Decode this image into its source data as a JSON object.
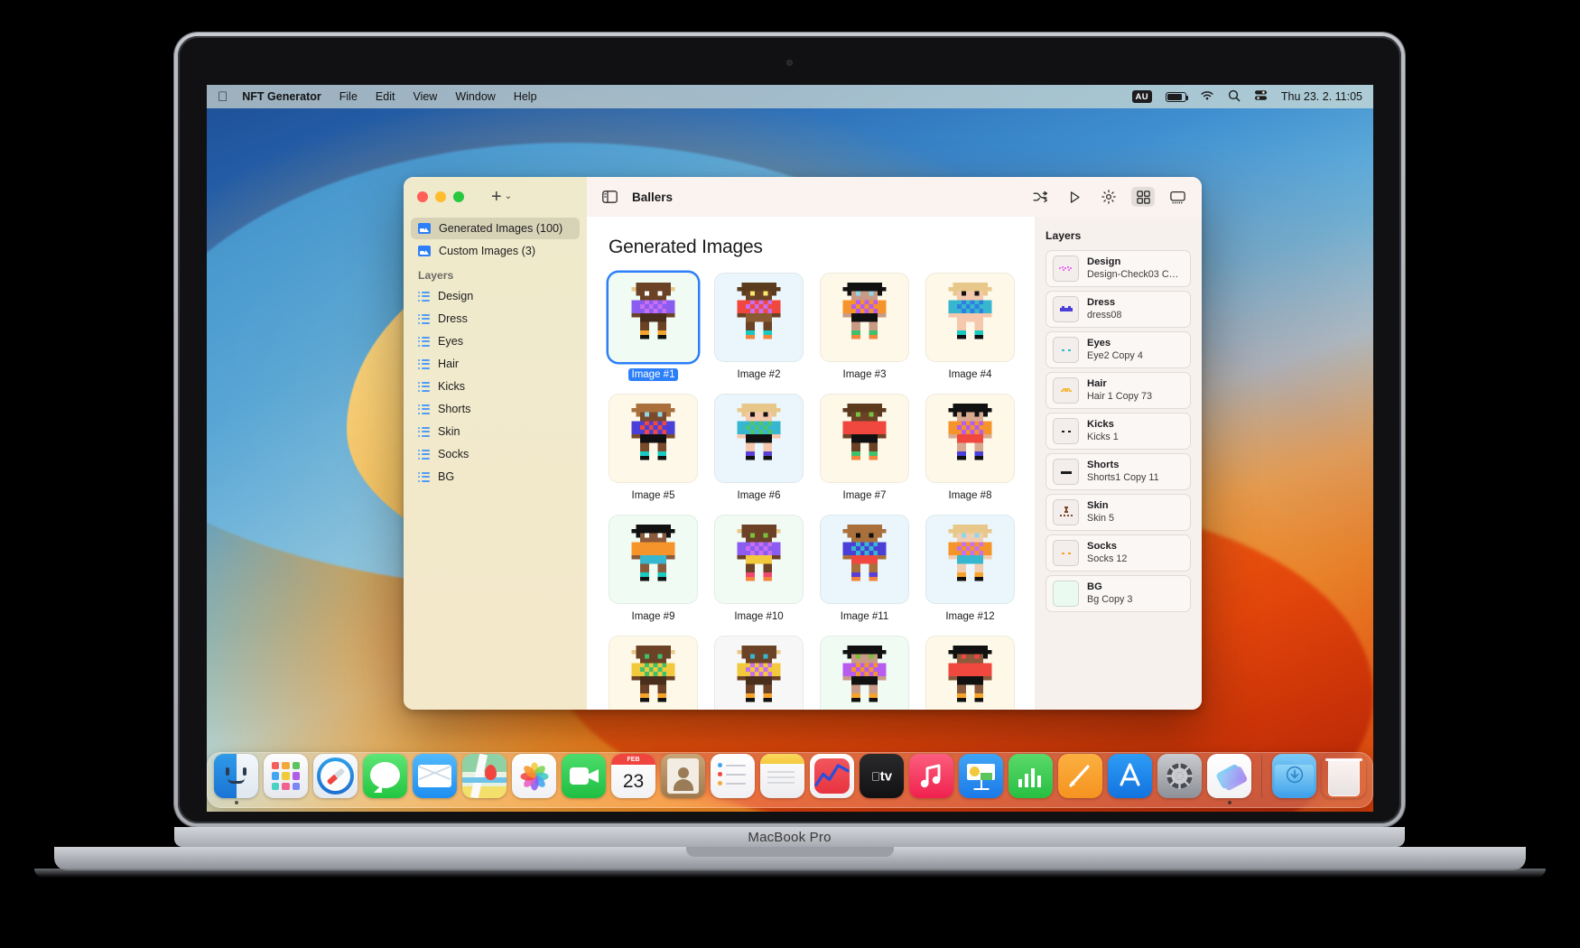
{
  "device": {
    "label": "MacBook Pro"
  },
  "menubar": {
    "apple_icon": "apple-logo",
    "app_name": "NFT Generator",
    "items": [
      "File",
      "Edit",
      "View",
      "Window",
      "Help"
    ],
    "status": {
      "input_source": "AU",
      "battery_icon": "battery-icon",
      "wifi_icon": "wifi-icon",
      "search_icon": "search-icon",
      "control_center_icon": "control-center-icon",
      "clock": "Thu 23. 2.  11:05"
    }
  },
  "window": {
    "title": "Ballers",
    "sidebar": {
      "add_label": "+",
      "chevron": "⌄",
      "top_items": [
        {
          "label": "Generated Images (100)",
          "icon": "photo-icon",
          "selected": true
        },
        {
          "label": "Custom Images (3)",
          "icon": "photo-icon",
          "selected": false
        }
      ],
      "section_header": "Layers",
      "layer_items": [
        {
          "label": "Design",
          "icon": "list-icon"
        },
        {
          "label": "Dress",
          "icon": "list-icon"
        },
        {
          "label": "Eyes",
          "icon": "list-icon"
        },
        {
          "label": "Hair",
          "icon": "list-icon"
        },
        {
          "label": "Kicks",
          "icon": "list-icon"
        },
        {
          "label": "Shorts",
          "icon": "list-icon"
        },
        {
          "label": "Skin",
          "icon": "list-icon"
        },
        {
          "label": "Socks",
          "icon": "list-icon"
        },
        {
          "label": "BG",
          "icon": "list-icon"
        }
      ]
    },
    "toolbar": {
      "sidebar_toggle_icon": "sidebar-toggle-icon",
      "actions": [
        {
          "icon": "shuffle-icon",
          "active": false
        },
        {
          "icon": "play-icon",
          "active": false
        },
        {
          "icon": "gear-icon",
          "active": false
        },
        {
          "icon": "grid-view-icon",
          "active": true
        },
        {
          "icon": "presentation-icon",
          "active": false
        }
      ]
    },
    "gallery": {
      "heading": "Generated Images",
      "items": [
        {
          "caption": "Image #1",
          "selected": true,
          "bg": "#effbf3"
        },
        {
          "caption": "Image #2",
          "selected": false,
          "bg": "#eaf6fb"
        },
        {
          "caption": "Image #3",
          "selected": false,
          "bg": "#fdf8e8"
        },
        {
          "caption": "Image #4",
          "selected": false,
          "bg": "#fdf8e8"
        },
        {
          "caption": "Image #5",
          "selected": false,
          "bg": "#fdf8e8"
        },
        {
          "caption": "Image #6",
          "selected": false,
          "bg": "#eaf6fb"
        },
        {
          "caption": "Image #7",
          "selected": false,
          "bg": "#fdf8e8"
        },
        {
          "caption": "Image #8",
          "selected": false,
          "bg": "#fdf8e8"
        },
        {
          "caption": "Image #9",
          "selected": false,
          "bg": "#effbf3"
        },
        {
          "caption": "Image #10",
          "selected": false,
          "bg": "#f1faf3"
        },
        {
          "caption": "Image #11",
          "selected": false,
          "bg": "#eaf6fb"
        },
        {
          "caption": "Image #12",
          "selected": false,
          "bg": "#eaf6fb"
        },
        {
          "caption": "",
          "selected": false,
          "bg": "#fdf8e8"
        },
        {
          "caption": "",
          "selected": false,
          "bg": "#f7f7f7"
        },
        {
          "caption": "",
          "selected": false,
          "bg": "#effbf3"
        },
        {
          "caption": "",
          "selected": false,
          "bg": "#fdf8e8"
        }
      ],
      "sprites": [
        {
          "hat": "#e8c88a",
          "hair": "#6b4226",
          "skin": "#6b4226",
          "shirt_a": "#8a5cf0",
          "shirt_b": "#c86ef0",
          "shorts": "#4a2e1c",
          "socks": "#f5a32a",
          "shoes": "#111111",
          "eyes": "#ffffff",
          "arms": "#8a5cf0"
        },
        {
          "hat": "#5b3a1e",
          "hair": "#5b3a1e",
          "skin": "#6b4226",
          "shirt_a": "#f0473f",
          "shirt_b": "#c86ef0",
          "shorts": "#8a5a32",
          "socks": "#18c9c0",
          "shoes": "#f2843c",
          "eyes": "#f7e96a",
          "arms": "#f0473f"
        },
        {
          "hat": "#111111",
          "hair": "#111111",
          "skin": "#c99a85",
          "shirt_a": "#f5942a",
          "shirt_b": "#b85cf0",
          "shorts": "#111111",
          "socks": "#3ec16a",
          "shoes": "#f2843c",
          "eyes": "#8fd6e8",
          "arms": "#f5942a"
        },
        {
          "hat": "#e8c88a",
          "hair": "#e8c88a",
          "skin": "#f5c7ad",
          "shirt_a": "#36b7cf",
          "shirt_b": "#2f7fe0",
          "shorts": "#f5c7ad",
          "socks": "#18c9c0",
          "shoes": "#111111",
          "eyes": "#111111",
          "arms": "#36b7cf"
        },
        {
          "hat": "#a9703c",
          "hair": "#a9703c",
          "skin": "#7a4a2c",
          "shirt_a": "#4a3fd6",
          "shirt_b": "#f0473f",
          "shorts": "#111111",
          "socks": "#18c9c0",
          "shoes": "#111111",
          "eyes": "#8fd6e8",
          "arms": "#4a3fd6"
        },
        {
          "hat": "#e8c88a",
          "hair": "#e8c88a",
          "skin": "#f5c7ad",
          "shirt_a": "#36b7cf",
          "shirt_b": "#4fc46a",
          "shorts": "#111111",
          "socks": "#5a3fd6",
          "shoes": "#111111",
          "eyes": "#111111",
          "arms": "#36b7cf"
        },
        {
          "hat": "#5b3a1e",
          "hair": "#5b3a1e",
          "skin": "#6b4226",
          "shirt_a": "#f0473f",
          "shirt_b": "#f0473f",
          "shorts": "#111111",
          "socks": "#3ec16a",
          "shoes": "#f2843c",
          "eyes": "#7ac13e",
          "arms": "#f0473f"
        },
        {
          "hat": "#111111",
          "hair": "#111111",
          "skin": "#d9a98f",
          "shirt_a": "#f5942a",
          "shirt_b": "#b85cf0",
          "shorts": "#f0473f",
          "socks": "#4a3fd6",
          "shoes": "#111111",
          "eyes": "#111111",
          "arms": "#f5942a"
        },
        {
          "hat": "#111111",
          "hair": "#111111",
          "skin": "#8a5a3c",
          "shirt_a": "#f5942a",
          "shirt_b": "#f5942a",
          "shorts": "#36b7cf",
          "socks": "#18c9c0",
          "shoes": "#111111",
          "eyes": "#ffffff",
          "arms": "#f5942a"
        },
        {
          "hat": "#e8c88a",
          "hair": "#6b4226",
          "skin": "#6b4226",
          "shirt_a": "#8a5cf0",
          "shirt_b": "#c86ef0",
          "shorts": "#f2c93c",
          "socks": "#f0476f",
          "shoes": "#f2843c",
          "eyes": "#7ac13e",
          "arms": "#8a5cf0"
        },
        {
          "hat": "#a9703c",
          "hair": "#a9703c",
          "skin": "#a9703c",
          "shirt_a": "#4a3fd6",
          "shirt_b": "#36b7cf",
          "shorts": "#f0473f",
          "socks": "#5a3fd6",
          "shoes": "#f2843c",
          "eyes": "#111111",
          "arms": "#4a3fd6"
        },
        {
          "hat": "#e8c88a",
          "hair": "#e8c88a",
          "skin": "#f0cdb0",
          "shirt_a": "#f5942a",
          "shirt_b": "#c86ef0",
          "shorts": "#36b7cf",
          "socks": "#f5a32a",
          "shoes": "#111111",
          "eyes": "#8fd6e8",
          "arms": "#f5942a"
        },
        {
          "hat": "#e8c88a",
          "hair": "#6b4226",
          "skin": "#6b4226",
          "shirt_a": "#f2c93c",
          "shirt_b": "#3ec16a",
          "shorts": "#4a2e1c",
          "socks": "#f5a32a",
          "shoes": "#111111",
          "eyes": "#3ec16a",
          "arms": "#f2c93c"
        },
        {
          "hat": "#e8c88a",
          "hair": "#6b4226",
          "skin": "#6b4226",
          "shirt_a": "#f2c93c",
          "shirt_b": "#c86ef0",
          "shorts": "#4a2e1c",
          "socks": "#f5a32a",
          "shoes": "#111111",
          "eyes": "#36b7cf",
          "arms": "#f2c93c"
        },
        {
          "hat": "#111111",
          "hair": "#111111",
          "skin": "#c99a85",
          "shirt_a": "#b85cf0",
          "shirt_b": "#f5942a",
          "shorts": "#111111",
          "socks": "#f5a32a",
          "shoes": "#111111",
          "eyes": "#7ac13e",
          "arms": "#b85cf0"
        },
        {
          "hat": "#111111",
          "hair": "#111111",
          "skin": "#8a5a3c",
          "shirt_a": "#f0473f",
          "shirt_b": "#f0473f",
          "shorts": "#111111",
          "socks": "#f5a32a",
          "shoes": "#111111",
          "eyes": "#f0473f",
          "arms": "#f0473f"
        }
      ]
    },
    "layers_panel": {
      "heading": "Layers",
      "rows": [
        {
          "name": "Design",
          "value": "Design-Check03 C…",
          "swatch": "#e86ef0",
          "thumb_bg": "#f3eeeb",
          "glyph": "dots"
        },
        {
          "name": "Dress",
          "value": "dress08",
          "swatch": "#4a3fd6",
          "thumb_bg": "#f3eeeb",
          "glyph": "bar"
        },
        {
          "name": "Eyes",
          "value": "Eye2 Copy 4",
          "swatch": "#36b7cf",
          "thumb_bg": "#f3eeeb",
          "glyph": "pair"
        },
        {
          "name": "Hair",
          "value": "Hair 1 Copy 73",
          "swatch": "#f5b942",
          "thumb_bg": "#f3eeeb",
          "glyph": "arc"
        },
        {
          "name": "Kicks",
          "value": "Kicks 1",
          "swatch": "#1c1c1e",
          "thumb_bg": "#f3eeeb",
          "glyph": "pair"
        },
        {
          "name": "Shorts",
          "value": "Shorts1 Copy 11",
          "swatch": "#1c1c1e",
          "thumb_bg": "#f3eeeb",
          "glyph": "dash"
        },
        {
          "name": "Skin",
          "value": "Skin 5",
          "swatch": "#7a4a2c",
          "thumb_bg": "#f3eeeb",
          "glyph": "figure"
        },
        {
          "name": "Socks",
          "value": "Socks 12",
          "swatch": "#f5a32a",
          "thumb_bg": "#f3eeeb",
          "glyph": "pair"
        },
        {
          "name": "BG",
          "value": "Bg Copy 3",
          "swatch": "#eafaf0",
          "thumb_bg": "#eafaf0",
          "glyph": "fill"
        }
      ]
    }
  },
  "dock": {
    "items": [
      {
        "name": "Finder",
        "running": true
      },
      {
        "name": "Launchpad",
        "running": false
      },
      {
        "name": "Safari",
        "running": false
      },
      {
        "name": "Messages",
        "running": false
      },
      {
        "name": "Mail",
        "running": false
      },
      {
        "name": "Maps",
        "running": false
      },
      {
        "name": "Photos",
        "running": false
      },
      {
        "name": "FaceTime",
        "running": false
      },
      {
        "name": "Calendar",
        "running": false,
        "month": "FEB",
        "day": "23"
      },
      {
        "name": "Contacts",
        "running": false
      },
      {
        "name": "Reminders",
        "running": false
      },
      {
        "name": "Notes",
        "running": false
      },
      {
        "name": "Stocks",
        "running": false
      },
      {
        "name": "TV",
        "running": false
      },
      {
        "name": "Music",
        "running": false
      },
      {
        "name": "Keynote",
        "running": false
      },
      {
        "name": "Numbers",
        "running": false
      },
      {
        "name": "Pages",
        "running": false
      },
      {
        "name": "App Store",
        "running": false
      },
      {
        "name": "System Settings",
        "running": false
      },
      {
        "name": "NFT Generator",
        "running": true
      }
    ],
    "trailing": [
      {
        "name": "Downloads"
      },
      {
        "name": "Trash"
      }
    ]
  }
}
